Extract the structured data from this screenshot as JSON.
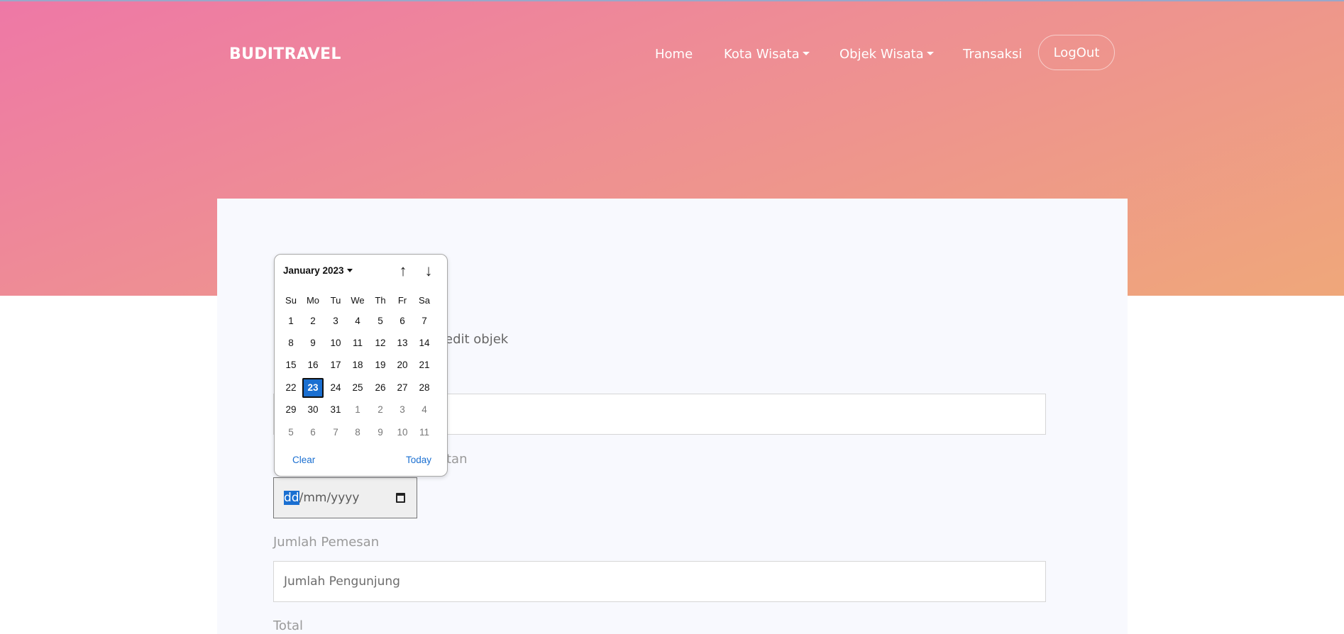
{
  "nav": {
    "brand": "BUDITRAVEL",
    "home": "Home",
    "kota_wisata": "Kota Wisata",
    "objek_wisata": "Objek Wisata",
    "transaksi": "Transaksi",
    "logout": "LogOut"
  },
  "form": {
    "intro_text_partial": "edit objek",
    "date_label_partial": "tan",
    "date_placeholder": {
      "day": "dd",
      "rest": "/mm/yyyy"
    },
    "jumlah_label": "Jumlah Pemesan",
    "jumlah_placeholder": "Jumlah Pengunjung",
    "total_label": "Total"
  },
  "datepicker": {
    "month_label": "January 2023",
    "weekdays": [
      "Su",
      "Mo",
      "Tu",
      "We",
      "Th",
      "Fr",
      "Sa"
    ],
    "weeks": [
      [
        "1",
        "2",
        "3",
        "4",
        "5",
        "6",
        "7"
      ],
      [
        "8",
        "9",
        "10",
        "11",
        "12",
        "13",
        "14"
      ],
      [
        "15",
        "16",
        "17",
        "18",
        "19",
        "20",
        "21"
      ],
      [
        "22",
        "23",
        "24",
        "25",
        "26",
        "27",
        "28"
      ],
      [
        "29",
        "30",
        "31",
        "1",
        "2",
        "3",
        "4"
      ],
      [
        "5",
        "6",
        "7",
        "8",
        "9",
        "10",
        "11"
      ]
    ],
    "selected_day": "23",
    "clear_label": "Clear",
    "today_label": "Today",
    "up_arrow": "↑",
    "down_arrow": "↓"
  },
  "colors": {
    "accent": "#1a6fd1",
    "hero_start": "#ee78a6",
    "hero_end": "#efa77a"
  }
}
